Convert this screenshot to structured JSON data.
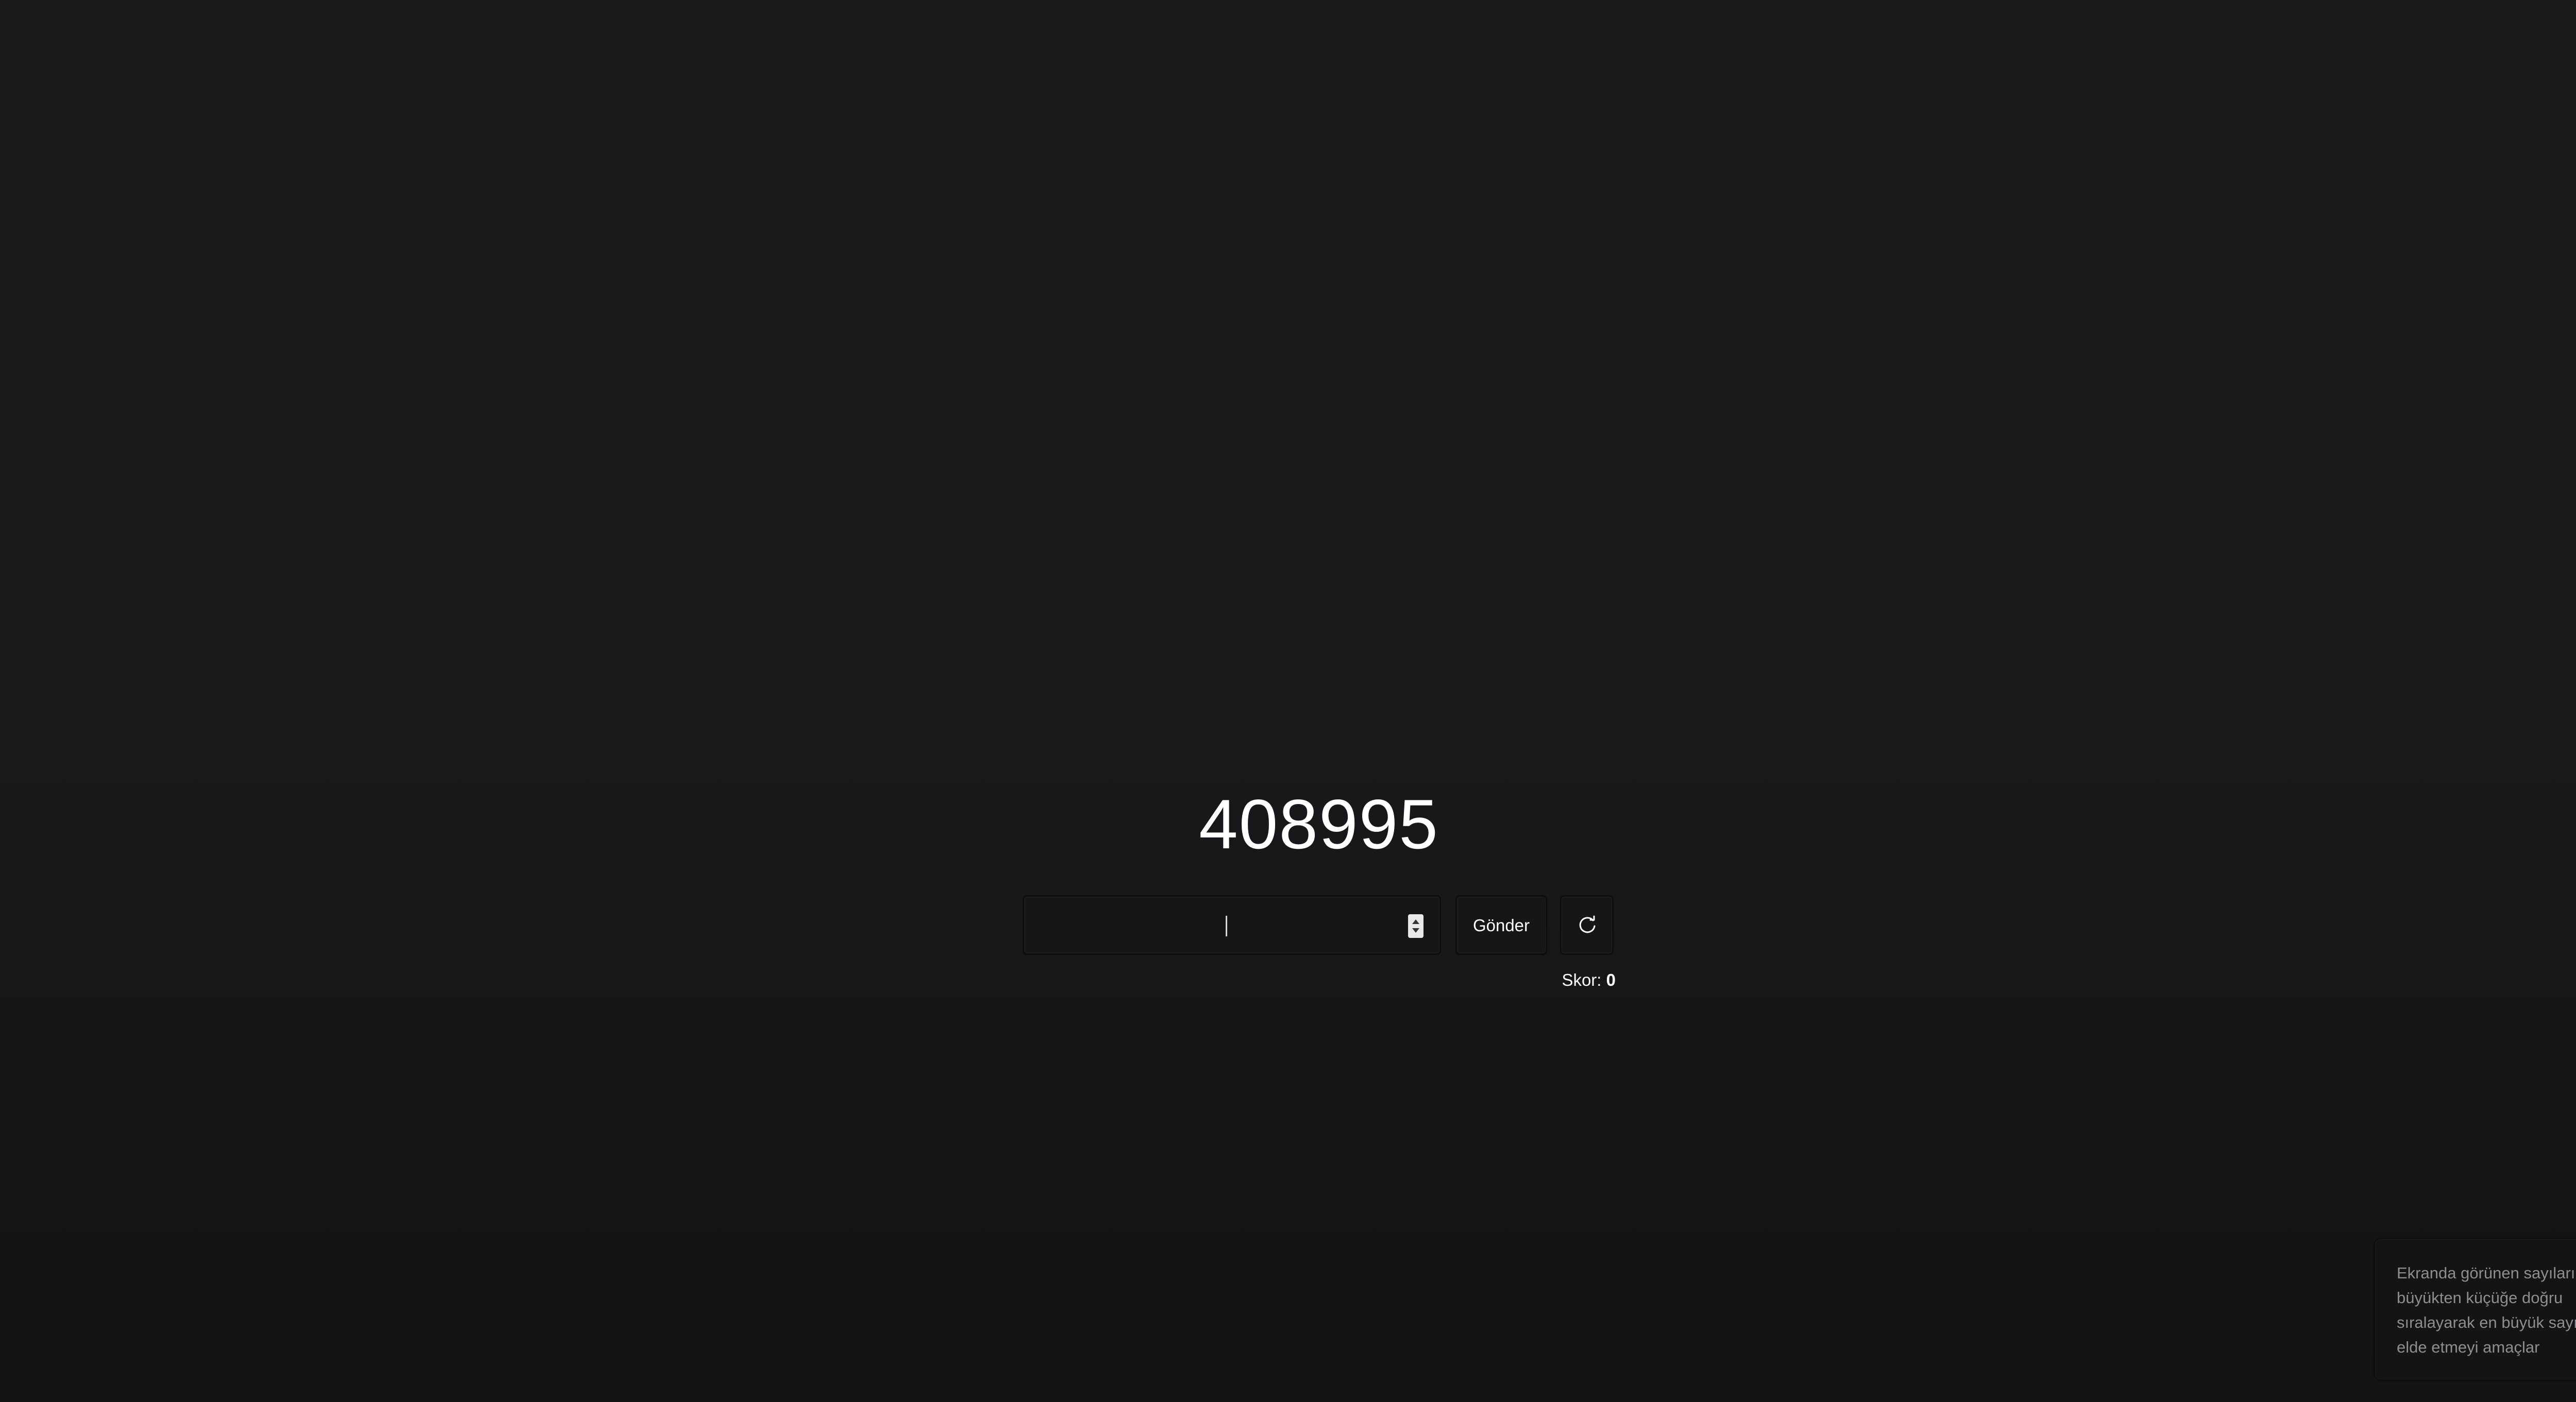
{
  "game": {
    "target_number": "408995"
  },
  "answer": {
    "value": "",
    "placeholder": ""
  },
  "buttons": {
    "submit_label": "Gönder",
    "reset_icon": "refresh-icon"
  },
  "score": {
    "label": "Skor:",
    "value": "0"
  },
  "hint": {
    "text": "Ekranda görünen sayıları büyükten küçüğe doğru sıralayarak en büyük sayıyı elde etmeyi amaçlar"
  },
  "colors": {
    "background": "#1a1a1c",
    "text": "#ffffff",
    "muted_text": "#8e8e92",
    "control_background": "#161618"
  }
}
